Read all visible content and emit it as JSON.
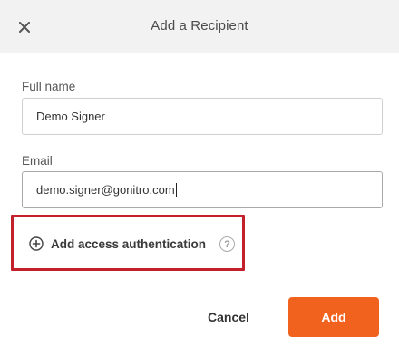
{
  "header": {
    "title": "Add a Recipient",
    "close_icon": "close-icon"
  },
  "form": {
    "full_name_label": "Full name",
    "full_name_value": "Demo Signer",
    "email_label": "Email",
    "email_value": "demo.signer@gonitro.com"
  },
  "auth": {
    "label": "Add access authentication",
    "icon": "plus-circle-icon",
    "help_icon_glyph": "?",
    "highlight_color": "#c2202a"
  },
  "actions": {
    "cancel_label": "Cancel",
    "add_label": "Add",
    "add_color": "#f2621f"
  }
}
